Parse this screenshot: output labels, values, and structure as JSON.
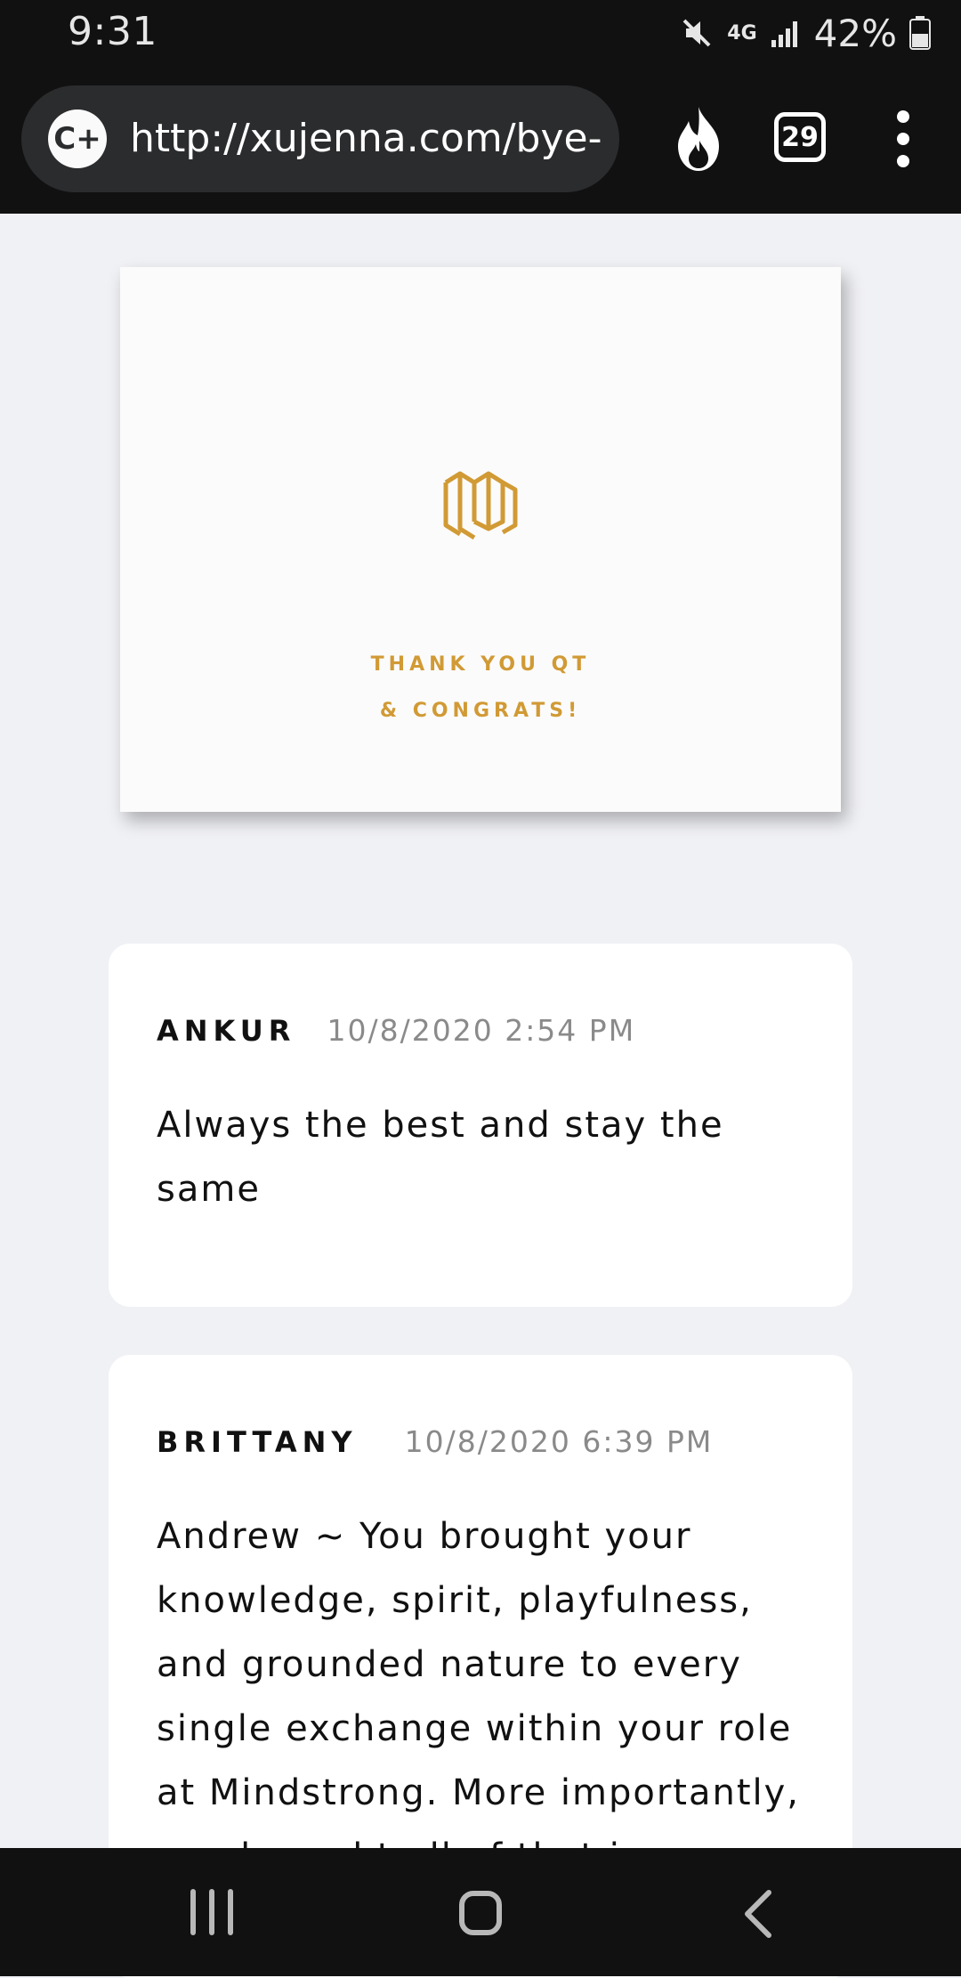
{
  "status": {
    "time": "9:31",
    "network": "4G",
    "battery": "42%"
  },
  "browser": {
    "url": "http://xujenna.com/bye-",
    "site_icon": "C+",
    "tab_count": "29"
  },
  "card": {
    "line1": "THANK YOU QT",
    "line2": "& CONGRATS!",
    "accent_color": "#d19a35"
  },
  "messages": [
    {
      "name": "ANKUR",
      "time": "10/8/2020 2:54 PM",
      "text": "Always the best and stay the same"
    },
    {
      "name": "BRITTANY",
      "time": "10/8/2020 6:39 PM",
      "text": "Andrew ~ You brought your knowledge, spirit, playfulness, and grounded nature to every single exchange within your role at Mindstrong. More importantly, you brought all of that in"
    }
  ],
  "nav": {
    "recents_icon": "recents-icon",
    "home_icon": "home-icon",
    "back_icon": "back-icon"
  }
}
